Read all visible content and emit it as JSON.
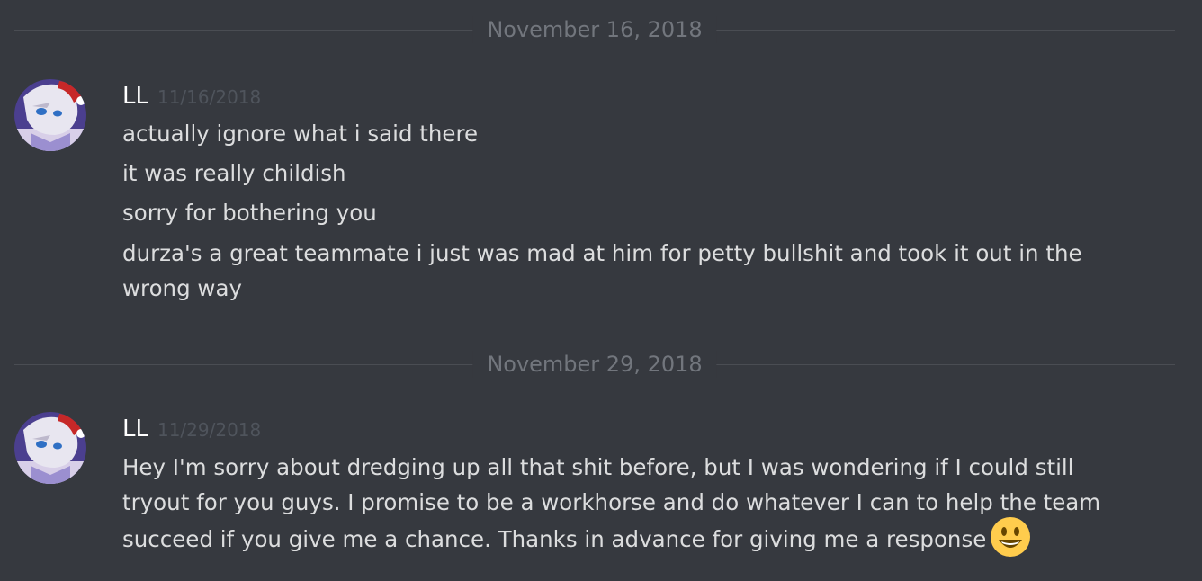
{
  "dividers": [
    {
      "label": "November 16, 2018"
    },
    {
      "label": "November 29, 2018"
    }
  ],
  "groups": [
    {
      "username": "LL",
      "timestamp": "11/16/2018",
      "messages": [
        "actually ignore what i said there",
        "it was really childish",
        "sorry for bothering you"
      ],
      "para_lines": [
        "durza's a great teammate i just was mad at him for petty bullshit and took it out in the",
        "wrong way"
      ]
    },
    {
      "username": "LL",
      "timestamp": "11/29/2018",
      "para_lines": [
        "Hey I'm sorry about dredging up all that shit before, but I was wondering if I could still",
        "tryout for you guys. I promise to be a workhorse and do whatever I can to help the team",
        "succeed if you give me a chance. Thanks in advance for giving me a response"
      ],
      "emoji": "smiley-emoji"
    }
  ],
  "colors": {
    "background": "#36393f",
    "text": "#dcddde",
    "username": "#ffffff",
    "timestamp": "#4f545c",
    "divider_text": "#72767d"
  }
}
